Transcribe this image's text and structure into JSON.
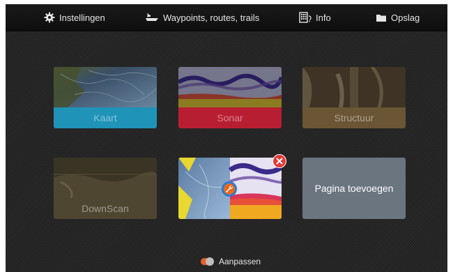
{
  "menu": {
    "settings": "Instellingen",
    "waypoints": "Waypoints, routes, trails",
    "info": "Info",
    "storage": "Opslag"
  },
  "tiles": {
    "chart": "Kaart",
    "sonar": "Sonar",
    "structure": "Structuur",
    "downscan": "DownScan",
    "add_page": "Pagina toevoegen"
  },
  "footer": {
    "customize": "Aanpassen"
  },
  "icons": {
    "settings": "gear-icon",
    "waypoints": "boat-icon",
    "info": "info-icon",
    "storage": "folder-icon",
    "close": "close-icon",
    "edit": "wrench-icon",
    "customize": "toggle-icon"
  },
  "colors": {
    "chart_label_bg": "#1f93b8",
    "sonar_label_bg": "#b81e32",
    "structure_label_bg": "#6a5534",
    "downscan_label_bg": "#4e4630",
    "add_tile_bg": "#6b7580",
    "close": "#e23b35",
    "edit": "#e86a1e"
  }
}
